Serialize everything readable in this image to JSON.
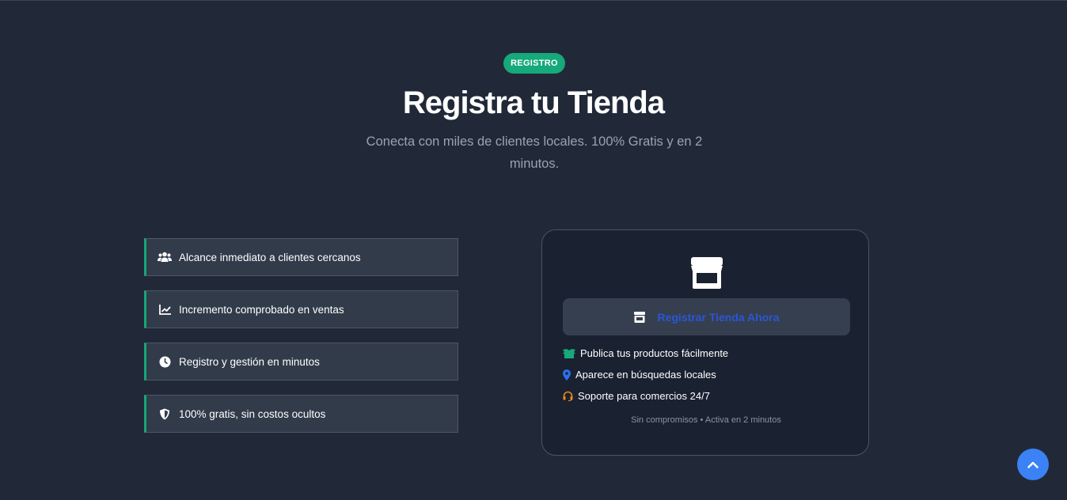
{
  "badge": "REGISTRO",
  "title": "Registra tu Tienda",
  "subtitle": "Conecta con miles de clientes locales. 100% Gratis y en 2 minutos.",
  "features": [
    {
      "icon": "users-icon",
      "label": "Alcance inmediato a clientes cercanos"
    },
    {
      "icon": "chart-line-icon",
      "label": "Incremento comprobado en ventas"
    },
    {
      "icon": "clock-icon",
      "label": "Registro y gestión en minutos"
    },
    {
      "icon": "shield-icon",
      "label": "100% gratis, sin costos ocultos"
    }
  ],
  "card": {
    "icon": "store-icon",
    "cta_label": "Registrar Tienda Ahora",
    "benefits": [
      {
        "icon": "box-open-icon",
        "label": "Publica tus productos fácilmente",
        "color": "#16a97a"
      },
      {
        "icon": "map-marker-icon",
        "label": "Aparece en búsquedas locales",
        "color": "#2a6ff0"
      },
      {
        "icon": "headset-icon",
        "label": "Soporte para comercios 24/7",
        "color": "#f08a1c"
      }
    ],
    "footnote": "Sin compromisos • Activa en 2 minutos"
  },
  "colors": {
    "background": "#212938",
    "accent_green": "#16a97a",
    "cta_text": "#2a56d6",
    "scroll_button": "#3b82f6"
  },
  "scroll_top_icon": "chevron-up-icon"
}
